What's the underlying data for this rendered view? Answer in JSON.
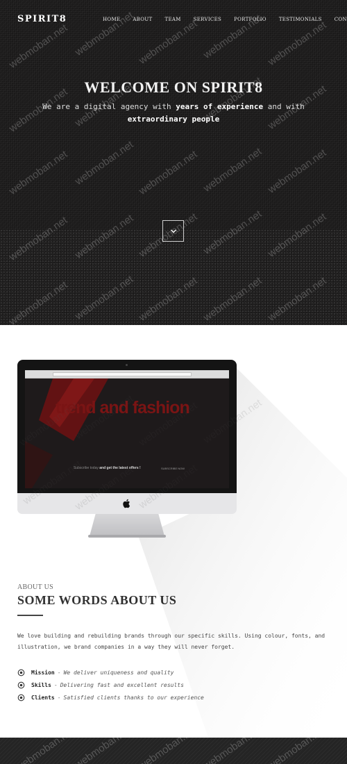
{
  "header": {
    "brand": "SPIRIT8",
    "nav": [
      "HOME",
      "ABOUT",
      "TEAM",
      "SERVICES",
      "PORTFOLIO",
      "TESTIMONIALS",
      "CONTACT"
    ]
  },
  "hero": {
    "title": "WELCOME ON SPIRIT8",
    "subtitle_1": "We are a digital agency with ",
    "subtitle_bold_1": "years of experience",
    "subtitle_2": " and with ",
    "subtitle_bold_2": "extraordinary people",
    "scroll_icon": "chevron-down-icon"
  },
  "showcase": {
    "headline": "trend and fashion",
    "offer_prefix": "Subscribe today ",
    "offer_bold": "and get the latest offers !",
    "button": "SUBSCRIBE NOW"
  },
  "about": {
    "kicker": "ABOUT US",
    "title_light": "SOME WORDS ",
    "title_bold": "ABOUT US",
    "text": "We love building and rebuilding brands through our specific skills. Using colour, fonts, and illustration, we brand companies in a way they will never forget.",
    "features": [
      {
        "label": "Mission",
        "desc": "We deliver uniqueness and quality"
      },
      {
        "label": "Skills",
        "desc": "Delivering fast and excellent results"
      },
      {
        "label": "Clients",
        "desc": "Satisfied clients thanks to our experience"
      }
    ],
    "feature_separator": "-"
  },
  "watermark": "webmoban.net",
  "colors": {
    "hero_bg": "#1a1919",
    "accent_red": "#7a1414",
    "text_dark": "#333333"
  }
}
